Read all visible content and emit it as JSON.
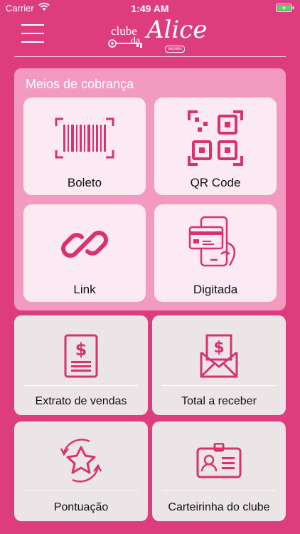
{
  "status_bar": {
    "carrier": "Carrier",
    "time": "1:49 AM"
  },
  "header": {
    "logo": {
      "line1": "clube",
      "line2": "da",
      "name": "Alice",
      "tag": "secreto"
    }
  },
  "payment_methods": {
    "title": "Meios de cobrança",
    "items": [
      {
        "label": "Boleto",
        "icon": "barcode-icon"
      },
      {
        "label": "QR Code",
        "icon": "qr-code-icon"
      },
      {
        "label": "Link",
        "icon": "link-icon"
      },
      {
        "label": "Digitada",
        "icon": "card-phone-icon"
      }
    ]
  },
  "menu_tiles": [
    {
      "label": "Extrato de vendas",
      "icon": "sales-statement-icon"
    },
    {
      "label": "Total a receber",
      "icon": "money-envelope-icon"
    },
    {
      "label": "Pontuação",
      "icon": "star-cycle-icon"
    },
    {
      "label": "Carteirinha do clube",
      "icon": "member-card-icon"
    }
  ],
  "colors": {
    "background": "#dd3d7f",
    "accent": "#d6336f",
    "card": "#f29ac0",
    "tile": "#fbeaf1"
  }
}
